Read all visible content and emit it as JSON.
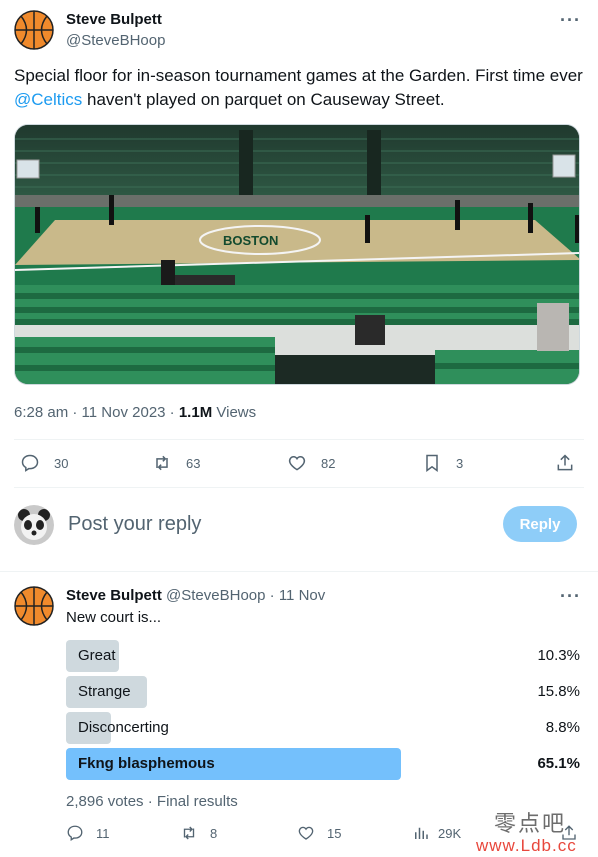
{
  "tweet": {
    "author_name": "Steve Bulpett",
    "author_handle": "@SteveBHoop",
    "more": "···",
    "text_before": "Special floor for in-season tournament games at the Garden. First time ever ",
    "mention": "@Celtics",
    "text_after": " haven't played on parquet on Causeway Street.",
    "time": "6:28 am",
    "date": "11 Nov 2023",
    "views_count": "1.1M",
    "views_label": "Views",
    "separator": "·",
    "actions": {
      "replies": "30",
      "retweets": "63",
      "likes": "82",
      "bookmarks": "3"
    }
  },
  "reply_box": {
    "placeholder": "Post your reply",
    "button": "Reply"
  },
  "reply_tweet": {
    "author_name": "Steve Bulpett",
    "author_handle": "@SteveBHoop",
    "dot": "·",
    "date": "11 Nov",
    "more": "···",
    "text": "New court is...",
    "poll": {
      "options": [
        {
          "label": "Great",
          "percent": "10.3%",
          "fraction": 0.103,
          "winner": false
        },
        {
          "label": "Strange",
          "percent": "15.8%",
          "fraction": 0.158,
          "winner": false
        },
        {
          "label": "Disconcerting",
          "percent": "8.8%",
          "fraction": 0.088,
          "winner": false
        },
        {
          "label": "Fkng blasphemous",
          "percent": "65.1%",
          "fraction": 0.651,
          "winner": true
        }
      ],
      "votes": "2,896 votes",
      "dot": "·",
      "status": "Final results"
    },
    "actions": {
      "replies": "11",
      "retweets": "8",
      "likes": "15",
      "views": "29K"
    }
  },
  "watermark": {
    "cn": "零点吧",
    "url": "www.Ldb.cc"
  },
  "colors": {
    "accent": "#1d9bf0",
    "poll_winner": "#74c0fc",
    "poll_other": "#cfd9de",
    "court_green": "#1f7a4c"
  }
}
